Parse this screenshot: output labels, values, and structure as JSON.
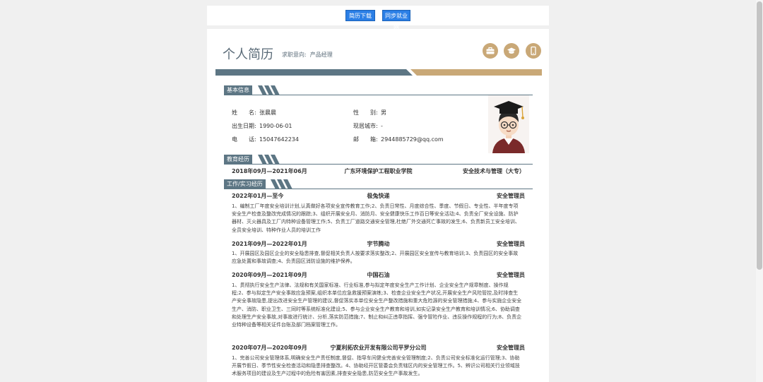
{
  "toolbar": {
    "download_label": "简历下载",
    "sync_label": "同步就业网"
  },
  "header": {
    "title": "个人简历",
    "intent_label": "求职意向:",
    "intent_value": "产品经理"
  },
  "icons": [
    "briefcase-icon",
    "graduation-cap-icon",
    "phone-icon"
  ],
  "colors": {
    "accent_slate": "#5d7684",
    "accent_gold": "#c9a877",
    "button_blue": "#2b7fe6"
  },
  "basic_info": {
    "heading": "基本信息",
    "name_label": "姓　　名:",
    "name": "张晨晨",
    "gender_label": "性　　别:",
    "gender": "男",
    "birth_label": "出生日期:",
    "birth": "1990-06-01",
    "city_label": "现居城市:",
    "city": "-",
    "phone_label": "电　　话:",
    "phone": "15047642234",
    "email_label": "邮　　箱:",
    "email": "2944885729@qq.com"
  },
  "education": {
    "heading": "教育经历",
    "items": [
      {
        "period": "2018年09月—2021年06月",
        "school": "广东环境保护工程职业学院",
        "major": "安全技术与管理（大专）"
      }
    ]
  },
  "work": {
    "heading": "工作/实习经历",
    "items": [
      {
        "period": "2022年01月—至今",
        "company": "极兔快递",
        "role": "安全管理员",
        "desc": "1、编制工厂年度安全培训计划,认真做好各项安全宣传教育工作;2、负责日常性、月度综合性、季度、节假日、专业性、半年度专项安全生产检查及整改完成情况的跟踪;3、组织开展安全月、消防月、安全健康快乐工作百日等安全活动;4、负责全厂安全设施、防护器材、灭火器具及工厂内特种设备管理工作;5、负责工厂道路交通安全管理,杜绝厂外交通死亡事故的发生;6、负责新员工安全培训、全员安全培训、特种作业人员的培训工作"
      },
      {
        "period": "2021年09月—2022年01月",
        "company": "宇节腾动",
        "role": "安全管理员",
        "desc": "1、开展园区及园区企业的安全隐患排查,督促相关负责人按要求落实整改;2、开展园区安全宣传与教育培训;3、负责园区的安全事故应急处置和事故调查;4、负责园区消防设施的维护保养。"
      },
      {
        "period": "2020年09月—2021年09月",
        "company": "中国石油",
        "role": "安全管理员",
        "desc": "1、贯彻执行安全生产法律、法规和有关国家标准、行业标准,参与拟定年度安全生产工作计划、企业安全生产规章制度、操作规程;2、参与拟定生产安全事故应急预案,组织本单位应急救援预案演练;3、检查企业安全生产状况,开展安全生产风险管控,及时排查生产安全事故隐患,提出改进安全生产管理的建议,督促落实本单位安全生产整改措施和重大危险源的安全管理措施;4、参与实施企业安全生产、消防、职业卫生、三同时等系统标准化建设;5、参与企业安全生产教育和培训,如实记录安全生产教育和培训情况;6、协助调查和处理生产安全事故,对事故进行统计、分析,落实防范措施;7、制止和纠正违章指挥、强令冒险作业、违反操作规程的行为;8、负责企业特种设备等相关证件台账及部门档案管理工作。"
      },
      {
        "period": "2020年07月—2020年09月",
        "company": "宁夏利拓农业开发有限公司平罗分公司",
        "role": "安全管理员",
        "desc": "1、完善公司安全管理体系,明确安全生产责任制度,督促、指导车间健全完善安全管理制度;2、负责公司安全标准化运行管理;3、协助开展节假日、季节性安全检查活动和隐患排查整改。4、协助经开区管委会负责辖区内的安全管理工作。5、辨识公司相关行业领域技术服务项目的建设及生产过程中的危险有害因素,排查安全隐患,防范安全生产事故发生。"
      }
    ]
  }
}
